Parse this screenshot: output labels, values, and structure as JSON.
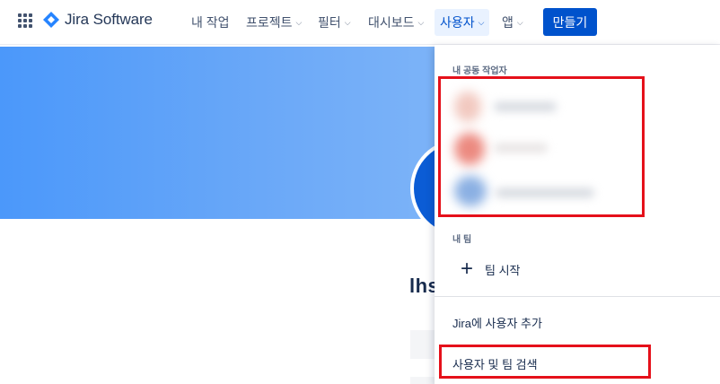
{
  "nav": {
    "logo_text": "Jira Software",
    "items": [
      {
        "label": "내 작업",
        "dropdown": false
      },
      {
        "label": "프로젝트",
        "dropdown": true
      },
      {
        "label": "필터",
        "dropdown": true
      },
      {
        "label": "대시보드",
        "dropdown": true
      },
      {
        "label": "사용자",
        "dropdown": true,
        "active": true
      },
      {
        "label": "앱",
        "dropdown": true
      }
    ],
    "create_label": "만들기",
    "chevron": "⌄"
  },
  "profile": {
    "name_partial": "lhs"
  },
  "menu": {
    "collaborators_title": "내 공동 작업자",
    "teams_title": "내 팀",
    "start_team_label": "팀 시작",
    "add_user_label": "Jira에 사용자 추가",
    "search_label": "사용자 및 팀 검색"
  },
  "colors": {
    "primary": "#0052cc",
    "banner": "#4b98fa",
    "highlight": "#e5101a"
  }
}
